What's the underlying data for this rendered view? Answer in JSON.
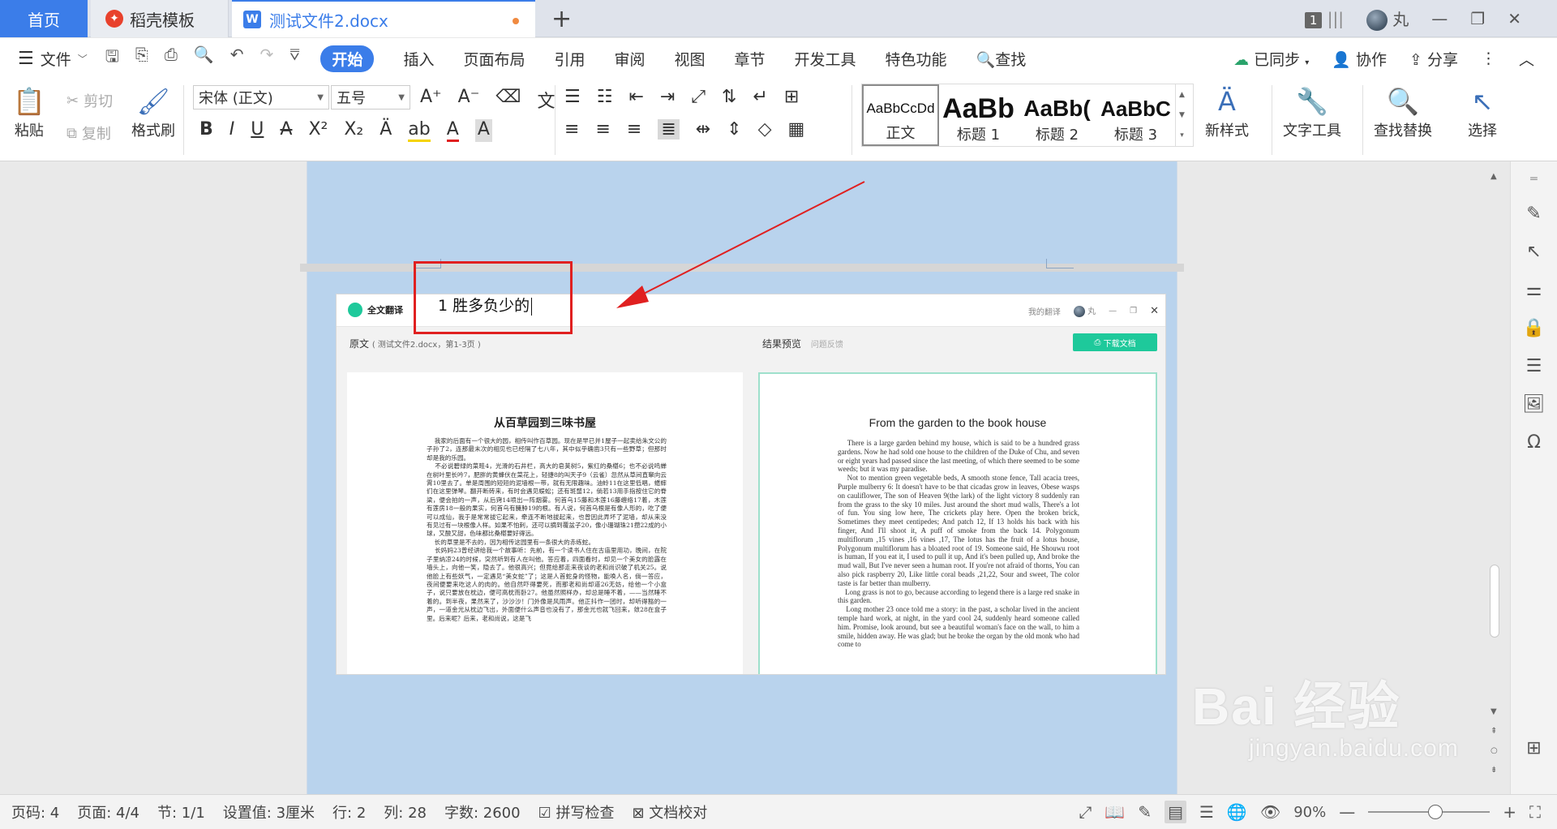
{
  "tabs": {
    "home": "首页",
    "template": "稻壳模板",
    "document": "测试文件2.docx",
    "add": "+"
  },
  "titlebar": {
    "window_count": "1",
    "user_name": "丸",
    "minimize": "—",
    "restore": "❐",
    "close": "✕"
  },
  "menu": {
    "file": "文件",
    "items": [
      "开始",
      "插入",
      "页面布局",
      "引用",
      "审阅",
      "视图",
      "章节",
      "开发工具",
      "特色功能"
    ],
    "search": "查找",
    "synced": "已同步",
    "collaborate": "协作",
    "share": "分享"
  },
  "ribbon": {
    "paste": "粘贴",
    "cut": "剪切",
    "copy": "复制",
    "format_painter": "格式刷",
    "font_name": "宋体 (正文)",
    "font_size": "五号",
    "styles": [
      {
        "preview": "AaBbCcDd",
        "label": "正文"
      },
      {
        "preview": "AaBb",
        "label": "标题 1"
      },
      {
        "preview": "AaBb(",
        "label": "标题 2"
      },
      {
        "preview": "AaBbC",
        "label": "标题 3"
      }
    ],
    "new_style": "新样式",
    "text_tools": "文字工具",
    "find_replace": "查找替换",
    "select": "选择"
  },
  "document": {
    "typed_text": "1 胜多负少的"
  },
  "embedded": {
    "app_name": "全文翻译",
    "my_translation": "我的翻译",
    "user": "丸",
    "source_label": "原文",
    "source_info": "( 测试文件2.docx，第1-3页 )",
    "preview_label": "结果预览",
    "feedback": "问题反馈",
    "download": "下载文档",
    "cn_title": "从百草园到三味书屋",
    "cn_text": "    我家的后面有一个很大的园，相传叫作百草园。现在是早已并1屋子一起卖给朱文公的子孙了2，连那最末次的相见也已经隔了七八年，其中似乎确凿3只有一些野草；但那时却是我的乐园。\n    不必说碧绿的菜畦4，光滑的石井栏，高大的皂荚树5，紫红的桑椹6；也不必说鸣蝉在树叶里长吟7，肥胖的黄蜂伏在菜花上，轻捷8的叫天子9（云雀）忽然从草间直窜向云霄10里去了。单是周围的短短的泥墙根一带，就有无限趣味。油蛉11在这里低唱，蟋蟀们在这里弹琴。翻开断砖来，有时会遇见蜈蚣；还有斑蝥12，倘若13用手指按住它的脊梁，便会拍的一声，从后窍14喷出一阵烟雾。何首乌15藤和木莲16藤缠络17着，木莲有莲房18一般的果实，何首乌有臃肿19的根。有人说，何首乌根是有像人形的，吃了便可以成仙，我于是常常拔它起来，牵连不断地拔起来，也曾因此弄坏了泥墙，却从来没有见过有一块根像人样。如果不怕刺，还可以摘到覆盆子20，像小珊瑚珠21攒22成的小球，又酸又甜，色味都比桑椹要好得远。\n    长的草里是不去的，因为相传这园里有一条很大的赤练蛇。\n    长妈妈23曾经讲给我一个故事听：先前，有一个读书人住在古庙里用功，晚间，在院子里纳凉24的时候，突然听到有人在叫他。答应着，四面看时，却见一个美女的脸露在墙头上，向他一笑，隐去了。他很高兴；但竟给那走来夜谈的老和尚识破了机关25。说他脸上有些妖气，一定遇见“美女蛇”了；这是人首蛇身的怪物，能唤人名，倘一答应，夜间便要来吃这人的肉的。他自然吓得要死，而那老和尚却道26无妨，给他一个小盒子，说只要放在枕边，便可高枕而卧27。他虽然照样办，却总是睡不着，——当然睡不着的。到半夜，果然来了，沙沙沙！门外像是风雨声。他正抖作一团时，却听得豁的一声，一道金光从枕边飞出，外面便什么声音也没有了，那金光也就飞回来，敛28在盒子里。后来呢？后来，老和尚说，这是飞",
    "en_title": "From the garden to the book house",
    "en_text": "    There is a large garden behind my house, which is said to be a hundred grass gardens. Now he had sold one house to the children of the Duke of Chu, and seven or eight years had passed since the last meeting, of which there seemed to be some weeds; but it was my paradise.\n    Not to mention green vegetable beds, A smooth stone fence, Tall acacia trees, Purple mulberry 6: It doesn't have to be that cicadas grow in leaves, Obese wasps on cauliflower, The son of Heaven 9(the lark) of the light victory 8 suddenly ran from the grass to the sky 10 miles. Just around the short mud walls, There's a lot of fun. You sing low here, The crickets play here. Open the broken brick, Sometimes they meet centipedes; And patch 12, If 13 holds his back with his finger, And I'll shoot it, A puff of smoke from the back 14. Polygonum multiflorum ,15 vines ,16 vines ,17, The lotus has the fruit of a lotus house, Polygonum multiflorum has a bloated root of 19. Someone said, He Shouwu root is human, If you eat it, I used to pull it up, And it's been pulled up, And broke the mud wall, But I've never seen a human root. If you're not afraid of thorns, You can also pick raspberry 20, Like little coral beads ,21,22, Sour and sweet, The color taste is far better than mulberry.\n    Long grass is not to go, because according to legend there is a large red snake in this garden.\n    Long mother 23 once told me a story: in the past, a scholar lived in the ancient temple hard work, at night, in the yard cool 24, suddenly heard someone called him. Promise, look around, but see a beautiful woman's face on the wall, to him a smile, hidden away. He was glad; but he broke the organ by the old monk who had come to"
  },
  "statusbar": {
    "page_code": "页码: 4",
    "page": "页面: 4/4",
    "section": "节: 1/1",
    "setting": "设置值: 3厘米",
    "row": "行: 2",
    "col": "列: 28",
    "word_count": "字数: 2600",
    "spell_check": "拼写检查",
    "proofread": "文档校对",
    "zoom": "90%",
    "zoom_fraction": 0.55
  },
  "watermark": {
    "main": "Bai  经验",
    "sub": "jingyan.baidu.com"
  }
}
